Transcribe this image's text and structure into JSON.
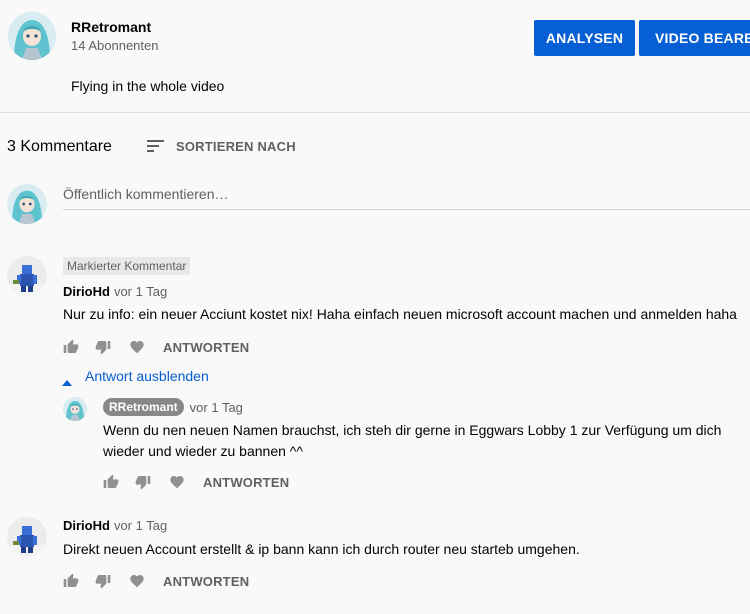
{
  "header": {
    "channel_name": "RRetromant",
    "subscribers": "14 Abonnenten",
    "analytics_label": "ANALYSEN",
    "edit_label": "VIDEO BEARBEITEN",
    "description": "Flying in the whole video"
  },
  "comments_header": {
    "count": "3 Kommentare",
    "sort_label": "SORTIEREN NACH"
  },
  "new_comment": {
    "placeholder": "Öffentlich kommentieren…"
  },
  "comments": [
    {
      "badge": "Markierter Kommentar",
      "author": "DirioHd",
      "time": "vor 1 Tag",
      "text": "Nur zu info: ein neuer Acciunt kostet nix! Haha einfach neuen microsoft account machen und anmelden haha",
      "reply_label": "ANTWORTEN",
      "toggle_replies": "Antwort ausblenden",
      "replies": [
        {
          "author": "RRetromant",
          "time": "vor 1 Tag",
          "text_line1": "Wenn du nen neuen Namen brauchst, ich steh dir gerne in Eggwars Lobby 1 zur Verfügung um dich",
          "text_line2": "wieder und wieder zu bannen ^^",
          "reply_label": "ANTWORTEN"
        }
      ]
    },
    {
      "author": "DirioHd",
      "time": "vor 1 Tag",
      "text": "Direkt neuen Account erstellt & ip bann kann ich durch router neu starteb umgehen.",
      "reply_label": "ANTWORTEN"
    }
  ],
  "colors": {
    "accent": "#065fd4",
    "secondary_text": "#606060",
    "background": "#f9f9f9"
  }
}
